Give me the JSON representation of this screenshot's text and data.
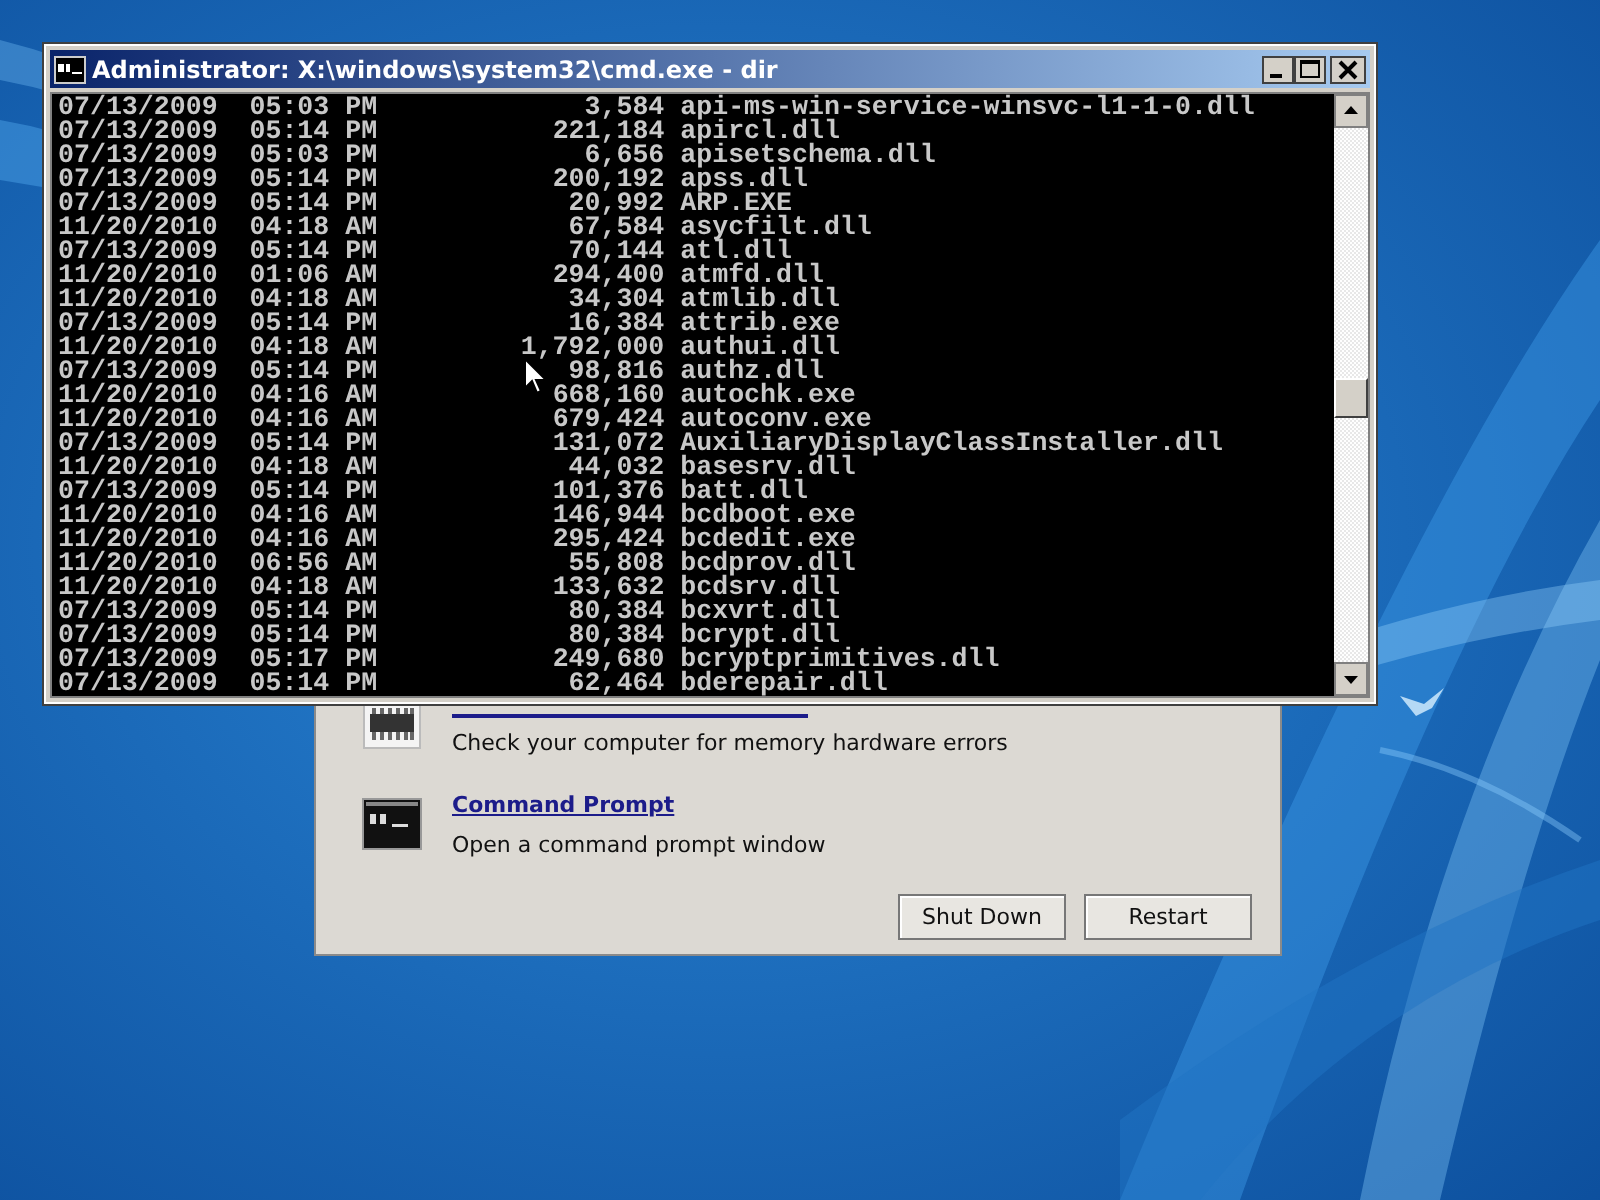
{
  "console": {
    "title": "Administrator: X:\\windows\\system32\\cmd.exe - dir",
    "lines": [
      {
        "date": "07/13/2009",
        "time": "05:03 PM",
        "size": "3,584",
        "name": "api-ms-win-service-winsvc-l1-1-0.dll"
      },
      {
        "date": "07/13/2009",
        "time": "05:14 PM",
        "size": "221,184",
        "name": "apircl.dll"
      },
      {
        "date": "07/13/2009",
        "time": "05:03 PM",
        "size": "6,656",
        "name": "apisetschema.dll"
      },
      {
        "date": "07/13/2009",
        "time": "05:14 PM",
        "size": "200,192",
        "name": "apss.dll"
      },
      {
        "date": "07/13/2009",
        "time": "05:14 PM",
        "size": "20,992",
        "name": "ARP.EXE"
      },
      {
        "date": "11/20/2010",
        "time": "04:18 AM",
        "size": "67,584",
        "name": "asycfilt.dll"
      },
      {
        "date": "07/13/2009",
        "time": "05:14 PM",
        "size": "70,144",
        "name": "atl.dll"
      },
      {
        "date": "11/20/2010",
        "time": "01:06 AM",
        "size": "294,400",
        "name": "atmfd.dll"
      },
      {
        "date": "11/20/2010",
        "time": "04:18 AM",
        "size": "34,304",
        "name": "atmlib.dll"
      },
      {
        "date": "07/13/2009",
        "time": "05:14 PM",
        "size": "16,384",
        "name": "attrib.exe"
      },
      {
        "date": "11/20/2010",
        "time": "04:18 AM",
        "size": "1,792,000",
        "name": "authui.dll"
      },
      {
        "date": "07/13/2009",
        "time": "05:14 PM",
        "size": "98,816",
        "name": "authz.dll"
      },
      {
        "date": "11/20/2010",
        "time": "04:16 AM",
        "size": "668,160",
        "name": "autochk.exe"
      },
      {
        "date": "11/20/2010",
        "time": "04:16 AM",
        "size": "679,424",
        "name": "autoconv.exe"
      },
      {
        "date": "07/13/2009",
        "time": "05:14 PM",
        "size": "131,072",
        "name": "AuxiliaryDisplayClassInstaller.dll"
      },
      {
        "date": "11/20/2010",
        "time": "04:18 AM",
        "size": "44,032",
        "name": "basesrv.dll"
      },
      {
        "date": "07/13/2009",
        "time": "05:14 PM",
        "size": "101,376",
        "name": "batt.dll"
      },
      {
        "date": "11/20/2010",
        "time": "04:16 AM",
        "size": "146,944",
        "name": "bcdboot.exe"
      },
      {
        "date": "11/20/2010",
        "time": "04:16 AM",
        "size": "295,424",
        "name": "bcdedit.exe"
      },
      {
        "date": "11/20/2010",
        "time": "06:56 AM",
        "size": "55,808",
        "name": "bcdprov.dll"
      },
      {
        "date": "11/20/2010",
        "time": "04:18 AM",
        "size": "133,632",
        "name": "bcdsrv.dll"
      },
      {
        "date": "07/13/2009",
        "time": "05:14 PM",
        "size": "80,384",
        "name": "bcxvrt.dll"
      },
      {
        "date": "07/13/2009",
        "time": "05:14 PM",
        "size": "80,384",
        "name": "bcrypt.dll"
      },
      {
        "date": "07/13/2009",
        "time": "05:17 PM",
        "size": "249,680",
        "name": "bcryptprimitives.dll"
      },
      {
        "date": "07/13/2009",
        "time": "05:14 PM",
        "size": "62,464",
        "name": "bderepair.dll"
      }
    ]
  },
  "dialog": {
    "tools": [
      {
        "kind": "memory",
        "description": "Check your computer for memory hardware errors"
      },
      {
        "kind": "prompt",
        "title": "Command Prompt",
        "description": "Open a command prompt window"
      }
    ],
    "buttons": [
      "Shut Down",
      "Restart"
    ]
  }
}
